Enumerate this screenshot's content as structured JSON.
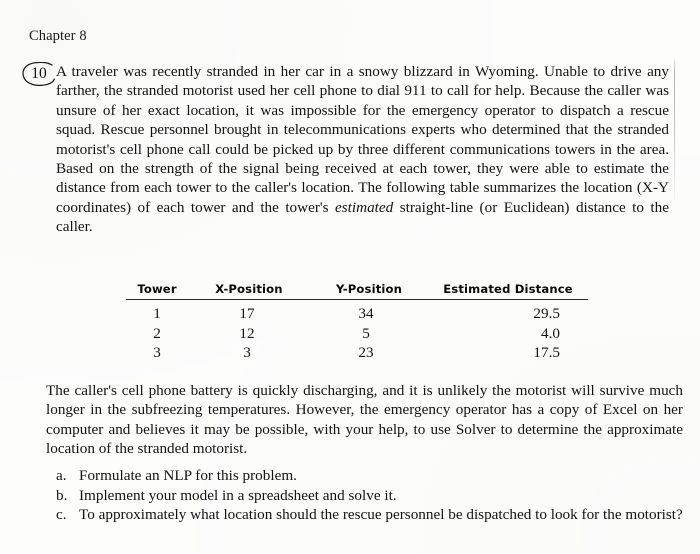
{
  "page": {
    "running_head": "Chapter 8",
    "problem_number": "10"
  },
  "problem": {
    "paragraph_1": "A traveler was recently stranded in her car in a snowy blizzard in Wyoming. Unable to drive any farther, the stranded motorist used her cell phone to dial 911 to call for help. Because the caller was unsure of her exact location, it was impossible for the emergency operator to dispatch a rescue squad. Rescue personnel brought in telecommunications experts who determined that the stranded motorist's cell phone call could be picked up by three different communications towers in the area. Based on the strength of the signal being received at each tower, they were able to estimate the distance from each tower to the caller's location. The following table summarizes the location (X-Y coordinates) of each tower and the tower's ",
    "paragraph_1_italic": "estimated",
    "paragraph_1_tail": " straight-line (or Euclidean) distance to the caller.",
    "paragraph_2": "The caller's cell phone battery is quickly discharging, and it is unlikely the motorist will survive much longer in the subfreezing temperatures. However, the emergency operator has a copy of Excel on her computer and believes it may be possible, with your help, to use Solver to determine the approximate location of the stranded motorist."
  },
  "table": {
    "columns": [
      "Tower",
      "X-Position",
      "Y-Position",
      "Estimated Distance"
    ],
    "rows": [
      {
        "tower": "1",
        "x": "17",
        "y": "34",
        "distance": "29.5"
      },
      {
        "tower": "2",
        "x": "12",
        "y": "5",
        "distance": "4.0"
      },
      {
        "tower": "3",
        "x": "3",
        "y": "23",
        "distance": "17.5"
      }
    ]
  },
  "questions": [
    {
      "marker": "a.",
      "text": "Formulate an NLP for this problem."
    },
    {
      "marker": "b.",
      "text": "Implement your model in a spreadsheet and solve it."
    },
    {
      "marker": "c.",
      "text": "To approximately what location should the rescue personnel be dispatched to look for the motorist?"
    }
  ],
  "colors": {
    "page_background": "#fdfdfc",
    "text": "#131313",
    "rule": "#2a2a2a"
  }
}
